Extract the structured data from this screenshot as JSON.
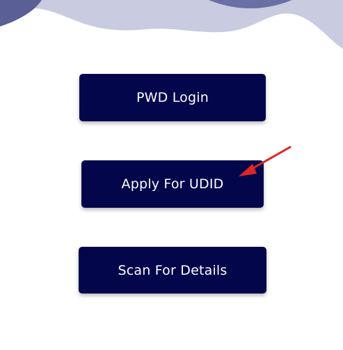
{
  "colors": {
    "button_bg": "#03064a",
    "button_text": "#ffffff",
    "wave_dark": "#5a5f96",
    "wave_light": "#c9cbe0",
    "annotation_arrow": "#e02424"
  },
  "buttons": {
    "pwd_login": "PWD Login",
    "apply_udid": "Apply For UDID",
    "scan_details": "Scan For Details"
  },
  "annotation": {
    "icon": "red-arrow-icon"
  }
}
